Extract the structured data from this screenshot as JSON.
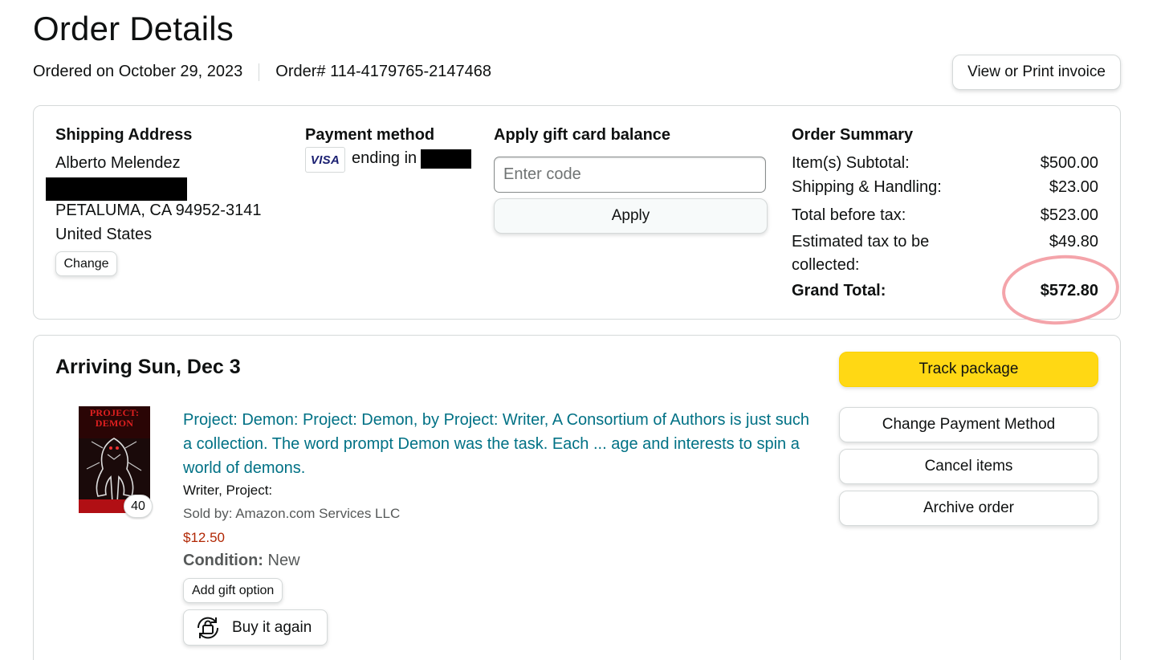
{
  "page": {
    "title": "Order Details"
  },
  "order": {
    "ordered_on": "Ordered on October 29, 2023",
    "order_number": "Order# 114-4179765-2147468",
    "invoice_label": "View or Print invoice"
  },
  "shipping": {
    "heading": "Shipping Address",
    "name": "Alberto Melendez",
    "city_line": "PETALUMA, CA 94952-3141",
    "country": "United States",
    "change_label": "Change"
  },
  "payment": {
    "heading": "Payment method",
    "card_brand": "VISA",
    "ending_text": "ending in"
  },
  "gift_card": {
    "heading": "Apply gift card balance",
    "placeholder": "Enter code",
    "apply_label": "Apply"
  },
  "summary": {
    "heading": "Order Summary",
    "rows": [
      {
        "label": "Item(s) Subtotal:",
        "value": "$500.00"
      },
      {
        "label": "Shipping & Handling:",
        "value": "$23.00"
      },
      {
        "label": "Total before tax:",
        "value": "$523.00"
      },
      {
        "label": "Estimated tax to be collected:",
        "value": "$49.80"
      }
    ],
    "grand_label": "Grand Total:",
    "grand_value": "$572.80",
    "highlight_color": "#f39aa1"
  },
  "shipment": {
    "arriving": "Arriving Sun, Dec 3",
    "item": {
      "cover_text": "PROJECT: DEMON",
      "quantity": "40",
      "title": "Project: Demon: Project: Demon, by Project: Writer, A Consortium of Authors is just such a collection. The word prompt Demon was the task. Each ... age and interests to spin a world of demons.",
      "author": "Writer, Project:",
      "seller": "Sold by: Amazon.com Services LLC",
      "price": "$12.50",
      "condition_label": "Condition:",
      "condition_value": "New",
      "gift_label": "Add gift option",
      "buy_again_label": "Buy it again"
    },
    "actions": {
      "track": "Track package",
      "change_payment": "Change Payment Method",
      "cancel": "Cancel items",
      "archive": "Archive order"
    }
  },
  "colors": {
    "link": "#007185",
    "price": "#b12704",
    "track_button": "#ffd814"
  }
}
